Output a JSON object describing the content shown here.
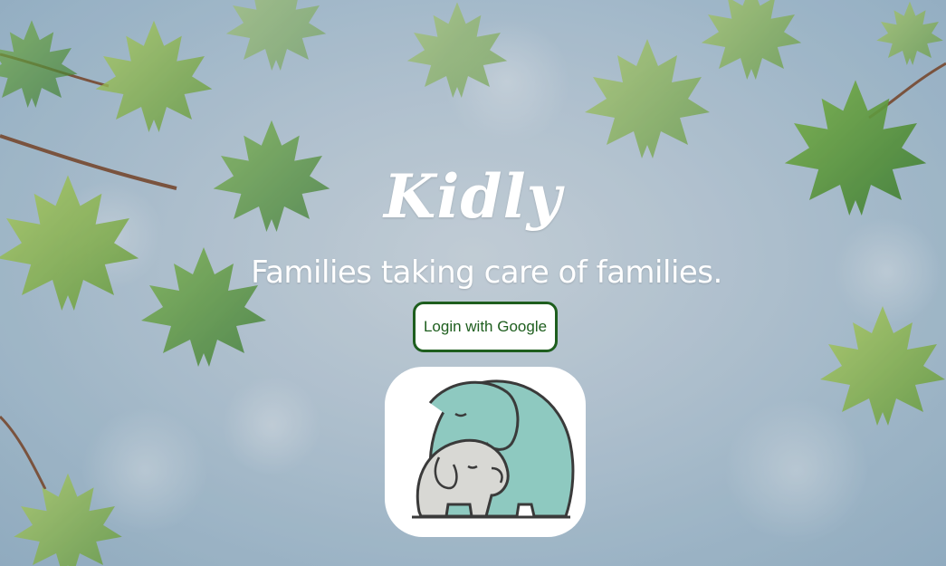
{
  "hero": {
    "title": "Kidly",
    "tagline": "Families taking care of families."
  },
  "auth": {
    "login_label": "Login with Google"
  },
  "logo": {
    "icon": "elephant-mother-and-baby-icon",
    "adult_color": "#8ec9c0",
    "baby_color": "#d8d8d4",
    "outline_color": "#3a3a3a"
  },
  "colors": {
    "button_accent": "#1e5e1e",
    "text": "#ffffff"
  }
}
